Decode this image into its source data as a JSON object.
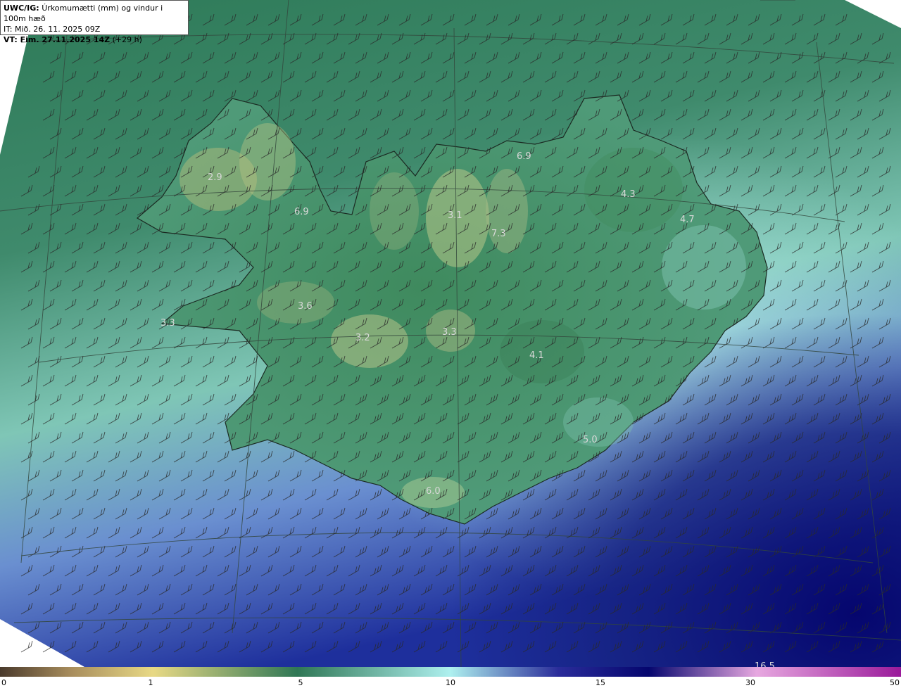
{
  "header": {
    "product": "UWC/IG:",
    "title": "Úrkomumætti (mm) og vindur i 100m hæð",
    "init_time": "IT: Mið. 26. 11. 2025 09Z",
    "valid_time_label": "VT: Fim. 27.11.2025 14Z",
    "lead": "(+29 h)"
  },
  "map_labels": [
    {
      "name": "label-westfjords",
      "text": "2.9"
    },
    {
      "name": "label-isafjord",
      "text": "6.9"
    },
    {
      "name": "label-snaefellsnes-west",
      "text": "3.3"
    },
    {
      "name": "label-snaefellsnes",
      "text": "3.6"
    },
    {
      "name": "label-borgarfjord",
      "text": "3.2"
    },
    {
      "name": "label-langjokull",
      "text": "3.3"
    },
    {
      "name": "label-trollaskagi",
      "text": "3.1"
    },
    {
      "name": "label-eyjafjord",
      "text": "7.3"
    },
    {
      "name": "label-north",
      "text": "6.9"
    },
    {
      "name": "label-northeast",
      "text": "4.3"
    },
    {
      "name": "label-east",
      "text": "4.7"
    },
    {
      "name": "label-vatnajokull",
      "text": "4.1"
    },
    {
      "name": "label-oraefi",
      "text": "5.0"
    },
    {
      "name": "label-myrdal",
      "text": "6.0"
    },
    {
      "name": "label-ocean",
      "text": "16.5"
    }
  ],
  "colorbar": {
    "ticks": [
      "0",
      "1",
      "5",
      "10",
      "15",
      "30",
      "50"
    ],
    "colors": [
      "#4a3a2c",
      "#a98e5d",
      "#e8d985",
      "#2f7755",
      "#aef0ef",
      "#2a2c9a",
      "#05066e",
      "#e7a8e0",
      "#9a1a9a"
    ]
  }
}
